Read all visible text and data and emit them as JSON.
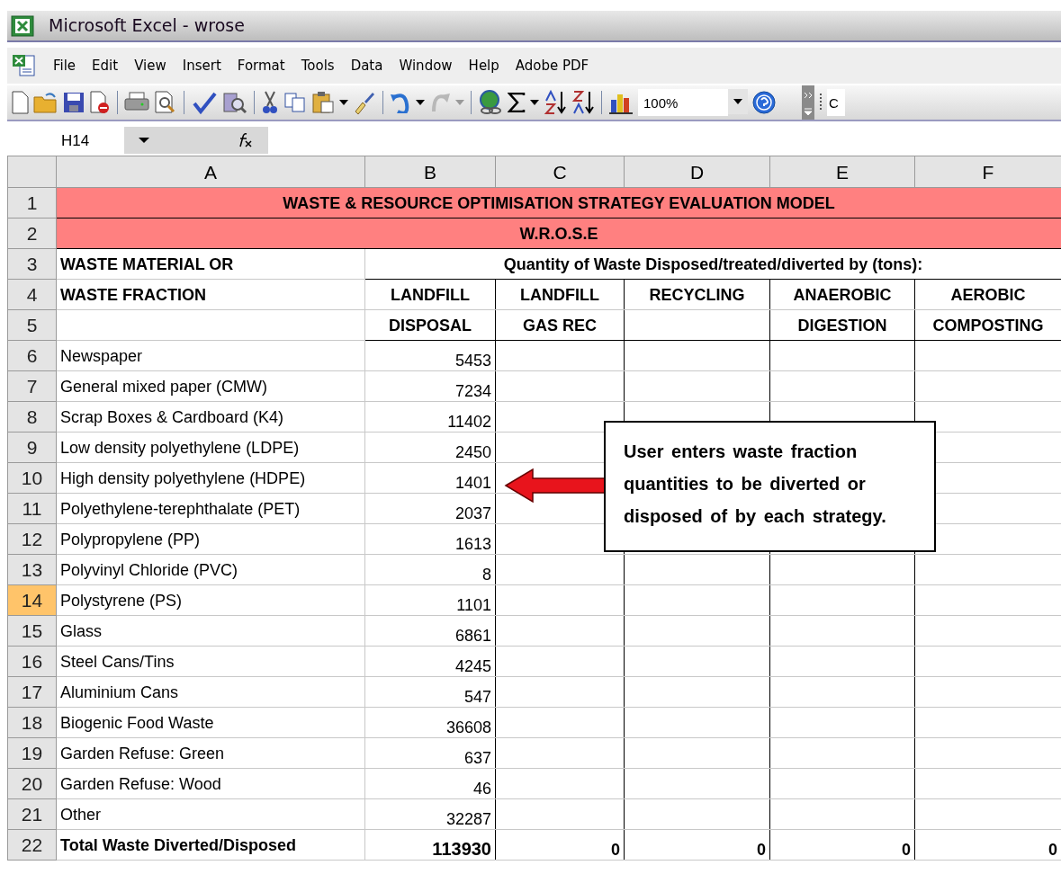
{
  "window": {
    "title": "Microsoft Excel - wrose"
  },
  "menu": [
    "File",
    "Edit",
    "View",
    "Insert",
    "Format",
    "Tools",
    "Data",
    "Window",
    "Help",
    "Adobe PDF"
  ],
  "toolbar": {
    "zoom": "100%",
    "cut_field": "C"
  },
  "formula_bar": {
    "name_box": "H14"
  },
  "sheet": {
    "columns": [
      "A",
      "B",
      "C",
      "D",
      "E",
      "F"
    ],
    "header_row_numbers": [
      "1",
      "2",
      "3",
      "4",
      "5"
    ],
    "title": "WASTE & RESOURCE OPTIMISATION STRATEGY EVALUATION MODEL",
    "subtitle": "W.R.O.S.E",
    "header_left": [
      "WASTE MATERIAL OR",
      "WASTE FRACTION"
    ],
    "header_right": "Quantity of Waste Disposed/treated/diverted by (tons):",
    "strategies": [
      {
        "line1": "LANDFILL",
        "line2": "DISPOSAL"
      },
      {
        "line1": "LANDFILL",
        "line2": "GAS REC"
      },
      {
        "line1": "RECYCLING"
      },
      {
        "line1": "ANAEROBIC",
        "line2": "DIGESTION"
      },
      {
        "line1": "AEROBIC",
        "line2": "COMPOSTING"
      }
    ],
    "rows": [
      {
        "number": "6",
        "material": "Newspaper",
        "disposal": "5453",
        "selected": false
      },
      {
        "number": "7",
        "material": "General mixed paper (CMW)",
        "disposal": "7234",
        "selected": false
      },
      {
        "number": "8",
        "material": "Scrap Boxes & Cardboard (K4)",
        "disposal": "11402",
        "selected": false
      },
      {
        "number": "9",
        "material": "Low density polyethylene (LDPE)",
        "disposal": "2450",
        "selected": false
      },
      {
        "number": "10",
        "material": "High density polyethylene (HDPE)",
        "disposal": "1401",
        "selected": false
      },
      {
        "number": "11",
        "material": "Polyethylene-terephthalate (PET)",
        "disposal": "2037",
        "selected": false
      },
      {
        "number": "12",
        "material": "Polypropylene (PP)",
        "disposal": "1613",
        "selected": false
      },
      {
        "number": "13",
        "material": "Polyvinyl Chloride (PVC)",
        "disposal": "8",
        "selected": false
      },
      {
        "number": "14",
        "material": "Polystyrene (PS)",
        "disposal": "1101",
        "selected": true
      },
      {
        "number": "15",
        "material": "Glass",
        "disposal": "6861",
        "selected": false
      },
      {
        "number": "16",
        "material": "Steel Cans/Tins",
        "disposal": "4245",
        "selected": false
      },
      {
        "number": "17",
        "material": "Aluminium Cans",
        "disposal": "547",
        "selected": false
      },
      {
        "number": "18",
        "material": "Biogenic Food Waste",
        "disposal": "36608",
        "selected": false
      },
      {
        "number": "19",
        "material": "Garden Refuse: Green",
        "disposal": "637",
        "selected": false
      },
      {
        "number": "20",
        "material": "Garden Refuse: Wood",
        "disposal": "46",
        "selected": false
      },
      {
        "number": "21",
        "material": "Other",
        "disposal": "32287",
        "selected": false
      }
    ],
    "total": {
      "number": "22",
      "label": "Total Waste Diverted/Disposed",
      "values": [
        "113930",
        "0",
        "0",
        "0",
        "0"
      ]
    }
  },
  "callout": {
    "lines": [
      "User enters waste fraction",
      "quantities to be diverted or",
      "disposed of by each strategy."
    ]
  }
}
